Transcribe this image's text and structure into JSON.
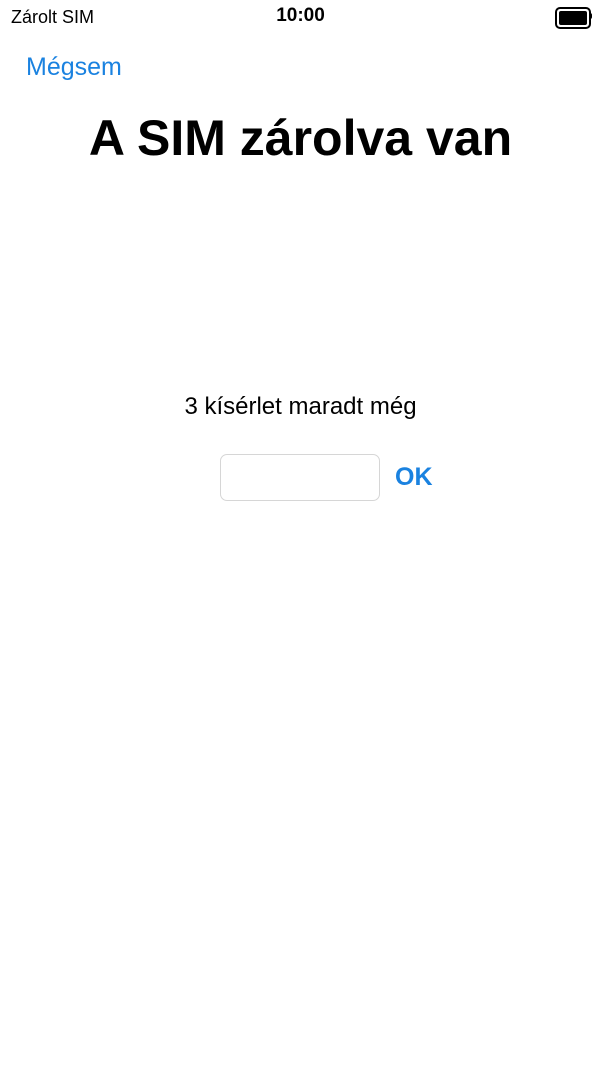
{
  "status_bar": {
    "carrier": "Zárolt SIM",
    "time": "10:00",
    "battery_level": 1.0
  },
  "nav": {
    "cancel_label": "Mégsem"
  },
  "main": {
    "title": "A SIM zárolva van",
    "attempts_text": "3 kísérlet maradt még",
    "pin_value": "",
    "ok_label": "OK"
  },
  "colors": {
    "accent": "#1a82e0",
    "background": "#ffffff",
    "text": "#000000",
    "input_border": "#d6d6d6"
  }
}
